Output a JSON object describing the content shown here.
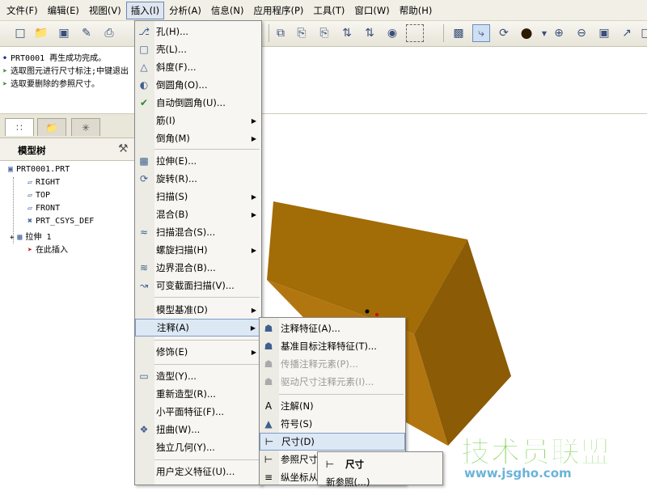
{
  "menubar": {
    "items": [
      "文件(F)",
      "编辑(E)",
      "视图(V)",
      "插入(I)",
      "分析(A)",
      "信息(N)",
      "应用程序(P)",
      "工具(T)",
      "窗口(W)",
      "帮助(H)"
    ]
  },
  "toolbar": {
    "icons": [
      "new-file-icon",
      "open-folder-icon",
      "save-icon",
      "edit-icon",
      "print-icon",
      "copy-icon",
      "paste-icon",
      "paste-special-icon",
      "regenerate-icon",
      "regenerate-manager-icon",
      "find-icon",
      "select-box-icon",
      "layer-icon",
      "datum-axis-icon",
      "spin-center-icon",
      "shade-sphere-icon",
      "zoom-in-icon",
      "zoom-out-icon",
      "refit-icon",
      "orient-icon",
      "view-manager-icon"
    ]
  },
  "messages": [
    "PRT0001 再生成功完成。",
    "选取图元进行尺寸标注;中键退出",
    "选取要删除的参照尺寸。"
  ],
  "navigator": {
    "tree_title": "模型树",
    "nodes": [
      "PRT0001.PRT",
      "RIGHT",
      "TOP",
      "FRONT",
      "PRT_CSYS_DEF",
      "拉伸 1",
      "在此插入"
    ]
  },
  "insert_menu": {
    "items": [
      {
        "label": "孔(H)...",
        "icon": "hole-icon",
        "submenu": false
      },
      {
        "label": "壳(L)...",
        "icon": "shell-icon",
        "submenu": false
      },
      {
        "label": "斜度(F)...",
        "icon": "draft-icon",
        "submenu": false
      },
      {
        "label": "倒圆角(O)...",
        "icon": "round-icon",
        "submenu": false
      },
      {
        "label": "自动倒圆角(U)...",
        "icon": "auto-round-icon",
        "submenu": false
      },
      {
        "label": "筋(I)",
        "icon": "",
        "submenu": true
      },
      {
        "label": "倒角(M)",
        "icon": "",
        "submenu": true
      },
      {
        "label": "拉伸(E)...",
        "icon": "extrude-icon",
        "submenu": false
      },
      {
        "label": "旋转(R)...",
        "icon": "revolve-icon",
        "submenu": false
      },
      {
        "label": "扫描(S)",
        "icon": "",
        "submenu": true
      },
      {
        "label": "混合(B)",
        "icon": "",
        "submenu": true
      },
      {
        "label": "扫描混合(S)...",
        "icon": "swept-blend-icon",
        "submenu": false
      },
      {
        "label": "螺旋扫描(H)",
        "icon": "",
        "submenu": true
      },
      {
        "label": "边界混合(B)...",
        "icon": "boundary-blend-icon",
        "submenu": false
      },
      {
        "label": "可变截面扫描(V)...",
        "icon": "variable-section-sweep-icon",
        "submenu": false
      },
      {
        "label": "模型基准(D)",
        "icon": "",
        "submenu": true
      },
      {
        "label": "注释(A)",
        "icon": "",
        "submenu": true
      },
      {
        "label": "修饰(E)",
        "icon": "",
        "submenu": true
      },
      {
        "label": "造型(Y)...",
        "icon": "style-icon",
        "submenu": false
      },
      {
        "label": "重新造型(R)...",
        "icon": "",
        "submenu": false
      },
      {
        "label": "小平面特征(F)...",
        "icon": "",
        "submenu": false
      },
      {
        "label": "扭曲(W)...",
        "icon": "warp-icon",
        "submenu": false
      },
      {
        "label": "独立几何(Y)...",
        "icon": "",
        "submenu": false
      },
      {
        "label": "用户定义特征(U)...",
        "icon": "",
        "submenu": false
      }
    ]
  },
  "annotation_menu": {
    "items": [
      {
        "label": "注释特征(A)...",
        "icon": "annotation-feature-icon",
        "disabled": false
      },
      {
        "label": "基准目标注释特征(T)...",
        "icon": "datum-target-icon",
        "disabled": false
      },
      {
        "label": "传播注释元素(P)...",
        "icon": "propagate-icon",
        "disabled": true
      },
      {
        "label": "驱动尺寸注释元素(I)...",
        "icon": "driving-dim-icon",
        "disabled": true
      },
      {
        "label": "注解(N)",
        "icon": "note-icon",
        "disabled": false
      },
      {
        "label": "符号(S)",
        "icon": "symbol-icon",
        "disabled": false
      },
      {
        "label": "尺寸(D)",
        "icon": "dimension-icon",
        "disabled": false
      },
      {
        "label": "参照尺寸(R)",
        "icon": "reference-dim-icon",
        "disabled": false
      },
      {
        "label": "纵坐标从...",
        "icon": "ordinate-icon",
        "disabled": false
      }
    ]
  },
  "dimension_submenu": {
    "items": [
      "尺寸",
      "新参照(...)"
    ]
  },
  "watermark": {
    "title": "技术员联盟",
    "url": "www.jsgho.com"
  },
  "colors": {
    "box_top": "#a16a06",
    "box_front": "#b6790f",
    "box_right": "#8a5b06",
    "highlight": "#dde8f5",
    "watermark_green": "#5fc42b"
  }
}
